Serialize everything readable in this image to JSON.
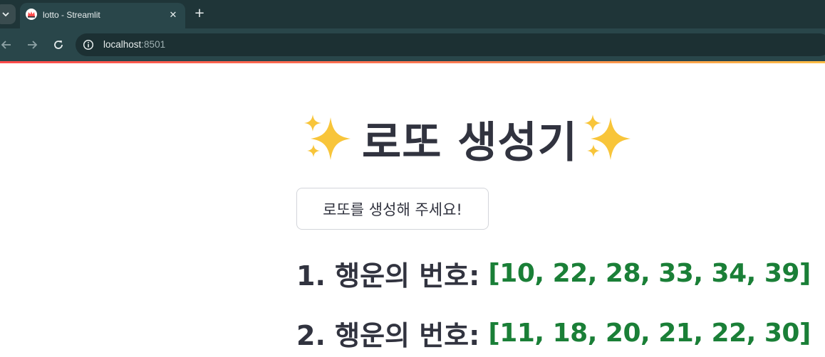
{
  "browser": {
    "tab_title": "lotto - Streamlit",
    "tab_close_glyph": "✕",
    "new_tab_glyph": "+",
    "url_host": "localhost",
    "url_port": ":8501",
    "icons": {
      "tab_list": "chevron-down-icon",
      "favicon": "streamlit-crown-icon",
      "back": "arrow-left-icon",
      "forward": "arrow-right-icon",
      "reload": "reload-icon",
      "site_info": "info-icon"
    }
  },
  "app": {
    "title_emoji_left": "sparkles-icon",
    "title": "로또 생성기",
    "title_emoji_right": "sparkles-icon",
    "generate_button_label": "로또를 생성해 주세요!",
    "results": [
      {
        "label": "1. 행운의 번호:",
        "numbers": "[10, 22, 28, 33, 34, 39]"
      },
      {
        "label": "2. 행운의 번호:",
        "numbers": "[11, 18, 20, 21, 22, 30]"
      }
    ]
  },
  "colors": {
    "browser_tabbar": "#1f3538",
    "browser_toolbar": "#29464a",
    "text_primary": "#31333f",
    "numbers_green": "#1a7f37",
    "sparkle": "#f8c53a",
    "decoration_gradient": [
      "#ff4b4b",
      "#ffbd45"
    ]
  }
}
